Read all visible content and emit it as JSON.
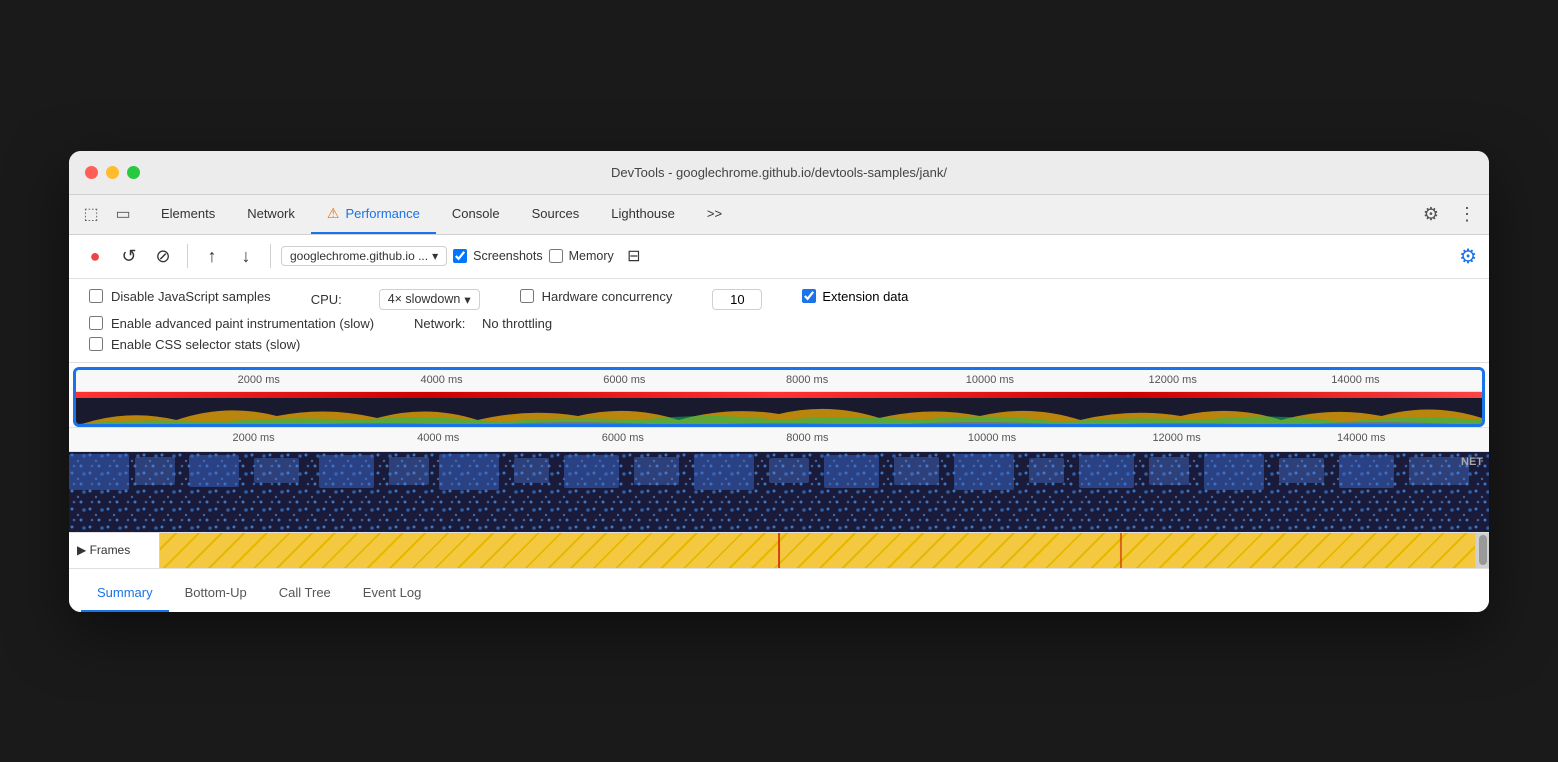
{
  "window": {
    "title": "DevTools - googlechrome.github.io/devtools-samples/jank/"
  },
  "titlebar_buttons": {
    "close": "close",
    "minimize": "minimize",
    "maximize": "maximize"
  },
  "tabs": [
    {
      "label": "Elements",
      "active": false
    },
    {
      "label": "Network",
      "active": false
    },
    {
      "label": "Performance",
      "active": true,
      "warning": true
    },
    {
      "label": "Console",
      "active": false
    },
    {
      "label": "Sources",
      "active": false
    },
    {
      "label": "Lighthouse",
      "active": false
    },
    {
      "label": ">>",
      "active": false
    }
  ],
  "toolbar": {
    "url": "googlechrome.github.io ...",
    "screenshots_label": "Screenshots",
    "memory_label": "Memory",
    "screenshots_checked": true,
    "memory_checked": false
  },
  "settings": {
    "disable_js_samples": "Disable JavaScript samples",
    "disable_js_checked": false,
    "enable_paint": "Enable advanced paint instrumentation (slow)",
    "enable_paint_checked": false,
    "enable_css": "Enable CSS selector stats (slow)",
    "enable_css_checked": false,
    "cpu_label": "CPU:",
    "cpu_value": "4× slowdown",
    "network_label": "Network:",
    "network_value": "No throttling",
    "hw_concurrency_label": "Hardware concurrency",
    "hw_checked": false,
    "hw_value": "10",
    "extension_label": "Extension data",
    "extension_checked": true
  },
  "timeline": {
    "ruler_marks": [
      "2000 ms",
      "4000 ms",
      "6000 ms",
      "8000 ms",
      "10000 ms",
      "12000 ms",
      "14000 ms"
    ],
    "ruler_marks_pct": [
      13,
      26,
      39,
      52,
      65,
      78,
      91
    ],
    "net_label": "NET"
  },
  "frames": {
    "label": "▶ Frames"
  },
  "bottom_tabs": [
    {
      "label": "Summary",
      "active": true
    },
    {
      "label": "Bottom-Up",
      "active": false
    },
    {
      "label": "Call Tree",
      "active": false
    },
    {
      "label": "Event Log",
      "active": false
    }
  ]
}
